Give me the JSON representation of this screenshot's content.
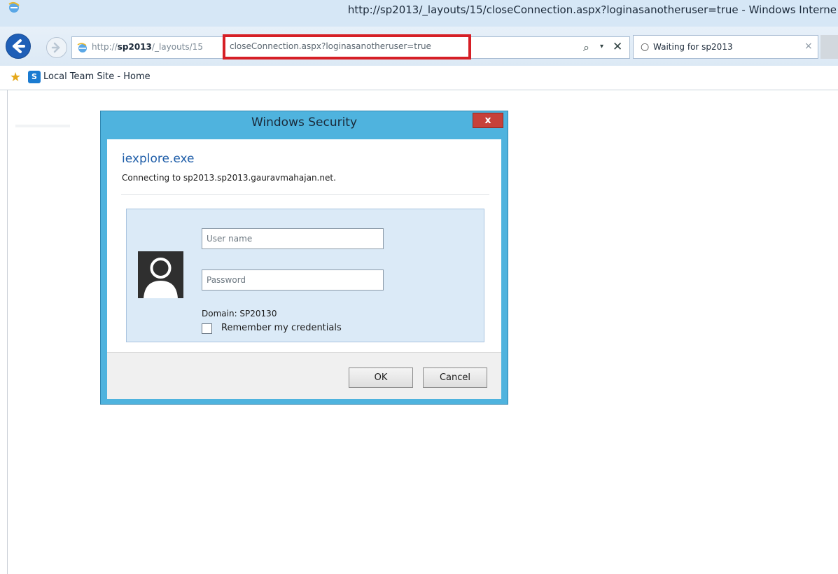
{
  "window": {
    "title": "http://sp2013/_layouts/15/closeConnection.aspx?loginasanotheruser=true - Windows Interne"
  },
  "address_bar": {
    "url_prefix_plain": "http://",
    "url_prefix_bold": "sp2013",
    "url_prefix_rest": "/_layouts/15",
    "url_highlighted": "closeConnection.aspx?loginasanotheruser=true",
    "highlight_color": "#d61f26"
  },
  "tab": {
    "title": "Waiting for sp2013",
    "close": "×"
  },
  "favorites_bar": {
    "sp_icon_letter": "S",
    "link_label": "Local Team Site - Home"
  },
  "dialog": {
    "title": "Windows Security",
    "close_label": "x",
    "app_name": "iexplore.exe",
    "connecting_text": "Connecting to sp2013.sp2013.gauravmahajan.net.",
    "username_placeholder": "User name",
    "password_placeholder": "Password",
    "domain_text": "Domain: SP20130",
    "remember_label": "Remember my credentials",
    "ok_label": "OK",
    "cancel_label": "Cancel",
    "accent_color": "#4fb3de"
  },
  "icons": {
    "search": "⌕",
    "dropdown": "▾",
    "stop": "✕",
    "spinner": "○",
    "star": "★"
  }
}
